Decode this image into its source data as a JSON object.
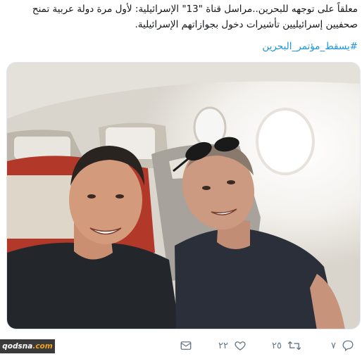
{
  "tweet": {
    "line1": "معلقاً على توجهه للبحرين..مراسل قناة \"13\" الإسرائيلية: لأول مرة دولة عربية تمنح",
    "line2": "صحفيين إسرائيليين تأشيرات دخول بجوازاتهم الإسرائيلية.",
    "hashtag": "#يسقط_مؤتمر_البحرين"
  },
  "watermark": {
    "site": "qodsna",
    "domain": ".com"
  },
  "actions": {
    "replies": "٧",
    "retweets": "٢٥",
    "likes": "٢٢"
  },
  "colors": {
    "link": "#1b95e0",
    "icon": "#657786"
  },
  "icons": [
    "reply-icon",
    "retweet-icon",
    "like-icon",
    "message-icon"
  ]
}
